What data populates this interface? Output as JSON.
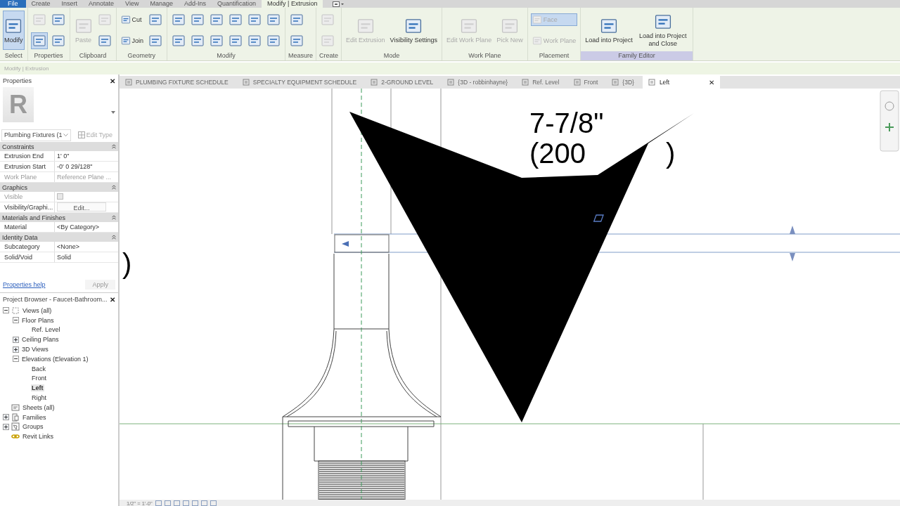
{
  "ribbon_tabs": [
    {
      "label": "File",
      "kind": "file",
      "selected": false
    },
    {
      "label": "Create",
      "kind": "tab",
      "selected": false
    },
    {
      "label": "Insert",
      "kind": "tab",
      "selected": false
    },
    {
      "label": "Annotate",
      "kind": "tab",
      "selected": false
    },
    {
      "label": "View",
      "kind": "tab",
      "selected": false
    },
    {
      "label": "Manage",
      "kind": "tab",
      "selected": false
    },
    {
      "label": "Add-Ins",
      "kind": "tab",
      "selected": false
    },
    {
      "label": "Quantification",
      "kind": "tab",
      "selected": false
    },
    {
      "label": "Modify | Extrusion",
      "kind": "tab",
      "selected": true
    }
  ],
  "ribbon_panels": [
    {
      "label": "Select",
      "highlighted": false,
      "tools": [
        {
          "kind": "large",
          "label": "Modify",
          "disabled": false,
          "selected": true
        }
      ]
    },
    {
      "label": "Properties",
      "highlighted": false,
      "tools": [
        {
          "kind": "icon",
          "disabled": true,
          "selected": false
        },
        {
          "kind": "icon",
          "disabled": false,
          "selected": true
        },
        {
          "kind": "icon",
          "disabled": false,
          "selected": false
        },
        {
          "kind": "icon",
          "disabled": false,
          "selected": false
        }
      ]
    },
    {
      "label": "Clipboard",
      "highlighted": false,
      "tools": [
        {
          "kind": "large",
          "label": "Paste",
          "disabled": true,
          "selected": false
        },
        {
          "kind": "icon",
          "disabled": true,
          "selected": false
        },
        {
          "kind": "icon",
          "disabled": false,
          "selected": false
        }
      ]
    },
    {
      "label": "Geometry",
      "highlighted": false,
      "tools": [
        {
          "kind": "small",
          "label": "Cut",
          "disabled": false,
          "selected": false
        },
        {
          "kind": "small",
          "label": "Join",
          "disabled": false,
          "selected": false
        },
        {
          "kind": "icon",
          "disabled": false,
          "selected": false
        },
        {
          "kind": "icon",
          "disabled": false,
          "selected": false
        }
      ]
    },
    {
      "label": "Modify",
      "highlighted": false,
      "tools": [
        {
          "kind": "icon",
          "disabled": false,
          "selected": false
        },
        {
          "kind": "icon",
          "disabled": false,
          "selected": false
        },
        {
          "kind": "icon",
          "disabled": false,
          "selected": false
        },
        {
          "kind": "icon",
          "disabled": false,
          "selected": false
        },
        {
          "kind": "icon",
          "disabled": false,
          "selected": false
        },
        {
          "kind": "icon",
          "disabled": false,
          "selected": false
        },
        {
          "kind": "icon",
          "disabled": false,
          "selected": false
        },
        {
          "kind": "icon",
          "disabled": false,
          "selected": false
        },
        {
          "kind": "icon",
          "disabled": false,
          "selected": false
        },
        {
          "kind": "icon",
          "disabled": false,
          "selected": false
        },
        {
          "kind": "icon",
          "disabled": false,
          "selected": false
        },
        {
          "kind": "icon",
          "disabled": false,
          "selected": false
        }
      ]
    },
    {
      "label": "Measure",
      "highlighted": false,
      "tools": [
        {
          "kind": "icon",
          "disabled": false,
          "selected": false
        },
        {
          "kind": "icon",
          "disabled": false,
          "selected": false
        }
      ]
    },
    {
      "label": "Create",
      "highlighted": false,
      "tools": [
        {
          "kind": "icon",
          "disabled": true,
          "selected": false
        },
        {
          "kind": "icon",
          "disabled": true,
          "selected": false
        }
      ]
    },
    {
      "label": "Mode",
      "highlighted": false,
      "tools": [
        {
          "kind": "large",
          "label": "Edit Extrusion",
          "disabled": true,
          "selected": false
        },
        {
          "kind": "large",
          "label": "Visibility Settings",
          "disabled": false,
          "selected": false
        }
      ]
    },
    {
      "label": "Work Plane",
      "highlighted": false,
      "tools": [
        {
          "kind": "large",
          "label": "Edit Work Plane",
          "disabled": true,
          "selected": false
        },
        {
          "kind": "large",
          "label": "Pick New",
          "disabled": true,
          "selected": false
        }
      ]
    },
    {
      "label": "Placement",
      "highlighted": false,
      "tools": [
        {
          "kind": "small",
          "label": "Face",
          "disabled": true,
          "selected": true
        },
        {
          "kind": "small",
          "label": "Work Plane",
          "disabled": true,
          "selected": false
        }
      ]
    },
    {
      "label": "Family Editor",
      "highlighted": true,
      "tools": [
        {
          "kind": "large",
          "label": "Load into Project",
          "disabled": false,
          "selected": false
        },
        {
          "kind": "large",
          "label": "Load into Project and Close",
          "disabled": false,
          "selected": false
        }
      ]
    }
  ],
  "options_bar": {
    "label": "Modify | Extrusion"
  },
  "properties": {
    "title": "Properties",
    "close": "✕",
    "type_logo": "R",
    "type_selector": "Plumbing Fixtures (1",
    "edit_type": "Edit Type",
    "groups": [
      {
        "name": "Constraints",
        "rows": [
          {
            "label": "Extrusion End",
            "value": "1'  0\"",
            "kind": "text",
            "disabled": false
          },
          {
            "label": "Extrusion Start",
            "value": "-0'  0 29/128\"",
            "kind": "text",
            "disabled": false
          },
          {
            "label": "Work Plane",
            "value": "Reference Plane ...",
            "kind": "text",
            "disabled": true
          }
        ]
      },
      {
        "name": "Graphics",
        "rows": [
          {
            "label": "Visible",
            "kind": "checkbox",
            "checked": false,
            "disabled": true
          },
          {
            "label": "Visibility/Graphi...",
            "value": "Edit...",
            "kind": "button",
            "disabled": false
          }
        ]
      },
      {
        "name": "Materials and Finishes",
        "rows": [
          {
            "label": "Material",
            "value": "<By Category>",
            "kind": "text",
            "disabled": false
          }
        ]
      },
      {
        "name": "Identity Data",
        "rows": [
          {
            "label": "Subcategory",
            "value": "<None>",
            "kind": "text",
            "disabled": false
          },
          {
            "label": "Solid/Void",
            "value": "Solid",
            "kind": "text",
            "disabled": false
          }
        ]
      }
    ],
    "help_link": "Properties help",
    "apply": "Apply"
  },
  "project_browser": {
    "title": "Project Browser - Faucet-Bathroom...",
    "close": "✕",
    "tree": [
      {
        "label": "Views (all)",
        "expanded": true,
        "selected": false,
        "children": [
          {
            "label": "Floor Plans",
            "expanded": true,
            "selected": false,
            "children": [
              {
                "label": "Ref. Level",
                "selected": false
              }
            ]
          },
          {
            "label": "Ceiling Plans",
            "expanded": false,
            "selected": false
          },
          {
            "label": "3D Views",
            "expanded": false,
            "selected": false
          },
          {
            "label": "Elevations (Elevation 1)",
            "expanded": true,
            "selected": false,
            "children": [
              {
                "label": "Back",
                "selected": false
              },
              {
                "label": "Front",
                "selected": false
              },
              {
                "label": "Left",
                "selected": true
              },
              {
                "label": "Right",
                "selected": false
              }
            ]
          }
        ]
      },
      {
        "label": "Sheets (all)",
        "selected": false
      },
      {
        "label": "Families",
        "expanded": false,
        "selected": false
      },
      {
        "label": "Groups",
        "expanded": false,
        "selected": false
      },
      {
        "label": "Revit Links",
        "selected": false
      }
    ]
  },
  "view_tabs": [
    {
      "label": "PLUMBING FIXTURE SCHEDULE",
      "selected": false
    },
    {
      "label": "SPECIALTY EQUIPMENT SCHEDULE",
      "selected": false
    },
    {
      "label": "2-GROUND LEVEL",
      "selected": false
    },
    {
      "label": "{3D - robbinhayne}",
      "selected": false
    },
    {
      "label": "Ref. Level",
      "selected": false
    },
    {
      "label": "Front",
      "selected": false
    },
    {
      "label": "{3D}",
      "selected": false
    },
    {
      "label": "Left",
      "selected": true,
      "close": "✕"
    }
  ],
  "canvas": {
    "dimension_texts": [
      "7-7/8\"",
      "(200",
      ")"
    ],
    "edge_text": ")"
  },
  "status_bar": {
    "scale": "1/2\" = 1'-0\""
  }
}
